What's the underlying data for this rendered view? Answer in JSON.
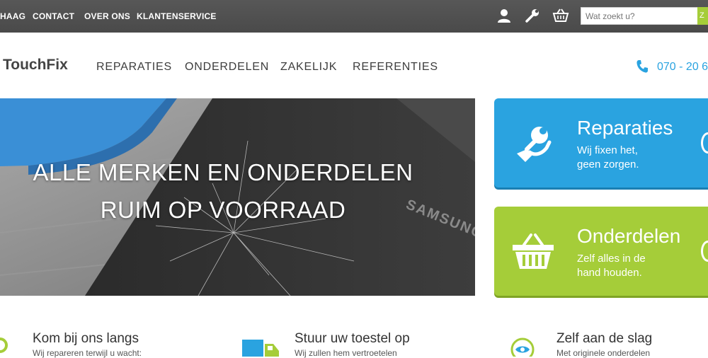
{
  "topbar": {
    "links": [
      "HAAG",
      "CONTACT",
      "OVER ONS",
      "KLANTENSERVICE"
    ],
    "search_placeholder": "Wat zoekt u?",
    "search_button": "Z"
  },
  "header": {
    "logo": "TouchFix",
    "nav": [
      "REPARATIES",
      "ONDERDELEN",
      "ZAKELIJK",
      "REFERENTIES"
    ],
    "phone": "070 - 20 6"
  },
  "hero": {
    "line1": "ALLE MERKEN EN ONDERDELEN",
    "line2": "RUIM OP VOORRAAD",
    "brand": "SAMSUNG"
  },
  "tiles": [
    {
      "title": "Reparaties",
      "sub1": "Wij fixen het,",
      "sub2": "geen zorgen.",
      "icon": "wrench-hand-icon"
    },
    {
      "title": "Onderdelen",
      "sub1": "Zelf alles in de",
      "sub2": "hand houden.",
      "icon": "basket-icon"
    }
  ],
  "features": [
    {
      "title": "Kom bij ons langs",
      "sub": "Wij repareren terwijl u wacht:",
      "icon": "location-icon"
    },
    {
      "title": "Stuur uw toestel op",
      "sub": "Wij zullen hem vertroetelen",
      "icon": "truck-icon"
    },
    {
      "title": "Zelf aan de slag",
      "sub": "Met originele onderdelen",
      "icon": "eye-icon"
    }
  ],
  "colors": {
    "blue": "#2aa3e0",
    "green": "#a5cd39",
    "topbar": "#4f4f4f"
  }
}
